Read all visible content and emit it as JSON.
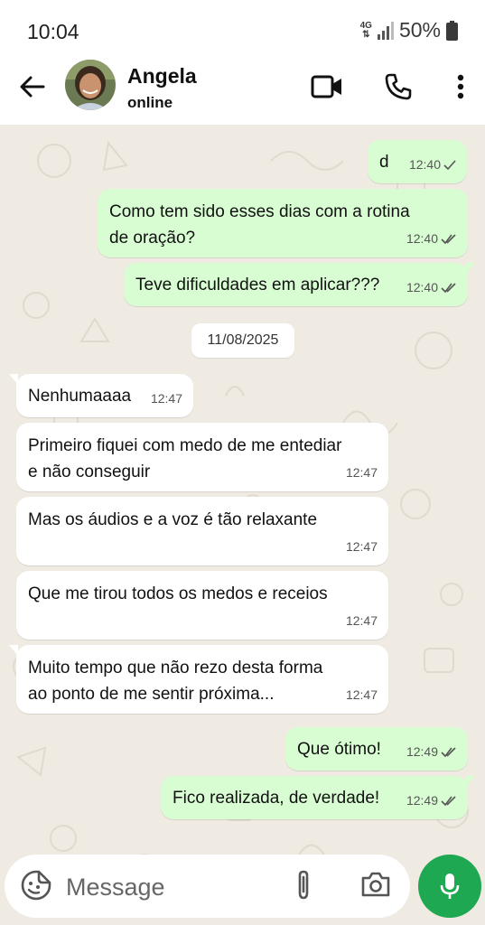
{
  "status_bar": {
    "time": "10:04",
    "network": "4G",
    "battery": "50%"
  },
  "header": {
    "contact_name": "Angela",
    "contact_status": "online"
  },
  "date_separator": "11/08/2025",
  "messages": [
    {
      "direction": "out",
      "lines": [
        "d"
      ],
      "time": "12:40",
      "ticks": "single-check-icon"
    },
    {
      "direction": "out",
      "lines": [
        "Como tem sido esses dias com a rotina",
        "de oração?"
      ],
      "time": "12:40",
      "ticks": "double-check-icon"
    },
    {
      "direction": "out",
      "lines": [
        "Teve dificuldades em aplicar???"
      ],
      "time": "12:40",
      "ticks": "double-check-icon"
    },
    {
      "direction": "in",
      "lines": [
        "Nenhumaaaa"
      ],
      "time": "12:47"
    },
    {
      "direction": "in",
      "lines": [
        "Primeiro fiquei com medo de me entediar",
        "e não conseguir"
      ],
      "time": "12:47"
    },
    {
      "direction": "in",
      "lines": [
        "Mas os áudios e a voz é tão relaxante"
      ],
      "time": "12:47"
    },
    {
      "direction": "in",
      "lines": [
        "Que me tirou todos os medos e receios"
      ],
      "time": "12:47"
    },
    {
      "direction": "in",
      "lines": [
        "Muito tempo que não rezo desta forma",
        "ao ponto de me sentir próxima..."
      ],
      "time": "12:47"
    },
    {
      "direction": "out",
      "lines": [
        "Que ótimo!"
      ],
      "time": "12:49",
      "ticks": "double-check-icon"
    },
    {
      "direction": "out",
      "lines": [
        "Fico realizada, de verdade!"
      ],
      "time": "12:49",
      "ticks": "double-check-icon"
    }
  ],
  "composer": {
    "placeholder": "Message"
  },
  "colors": {
    "outgoing_bubble": "#d9fdd3",
    "incoming_bubble": "#ffffff",
    "chat_background": "#efeae2",
    "mic_button": "#1da851"
  }
}
